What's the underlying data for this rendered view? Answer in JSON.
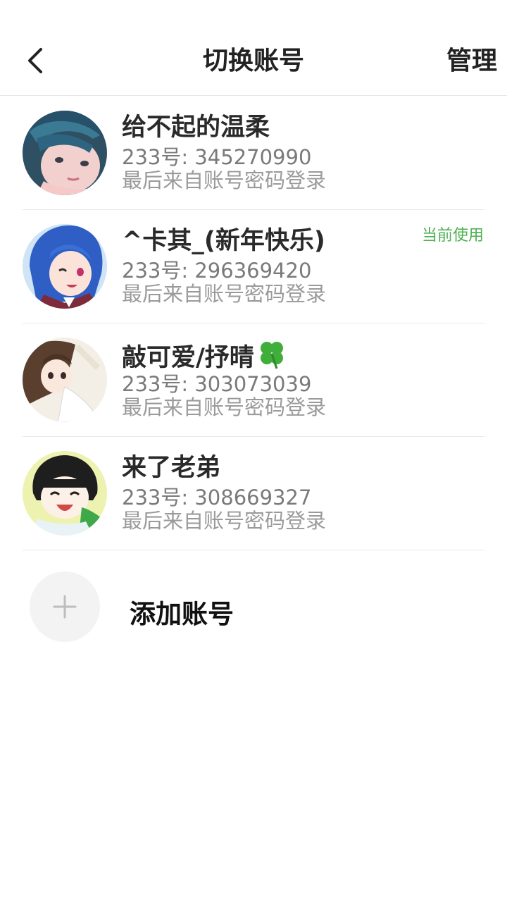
{
  "header": {
    "back_icon": "chevron-left-icon",
    "title": "切换账号",
    "manage_label": "管理"
  },
  "accounts": [
    {
      "name": "给不起的温柔",
      "uid": "233号: 345270990",
      "login_method": "最后来自账号密码登录",
      "current": false
    },
    {
      "name": "^卡其_(新年快乐)",
      "uid": "233号: 296369420",
      "login_method": "最后来自账号密码登录",
      "current": true,
      "current_label": "当前使用"
    },
    {
      "name": "敲可爱/抒晴",
      "name_suffix_icon": "four-leaf-clover-icon",
      "uid": "233号: 303073039",
      "login_method": "最后来自账号密码登录",
      "current": false
    },
    {
      "name": "来了老弟",
      "uid": "233号: 308669327",
      "login_method": "最后来自账号密码登录",
      "current": false
    }
  ],
  "add_account": {
    "icon": "plus-icon",
    "label": "添加账号"
  },
  "colors": {
    "current_badge": "#4caf50",
    "divider": "#e8e8e8",
    "add_circle_bg": "#f3f3f3"
  }
}
